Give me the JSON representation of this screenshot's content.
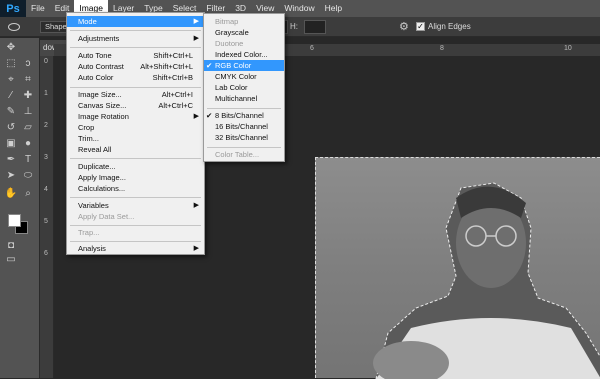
{
  "app": {
    "logo": "Ps"
  },
  "menubar": [
    "File",
    "Edit",
    "Image",
    "Layer",
    "Type",
    "Select",
    "Filter",
    "3D",
    "View",
    "Window",
    "Help"
  ],
  "options_bar": {
    "shape_label": "Shape",
    "height_label": "H:",
    "align_edges": "Align Edges"
  },
  "document_tab": "dow",
  "ruler_v": [
    "0",
    "1",
    "2",
    "3",
    "4",
    "5",
    "6"
  ],
  "ruler_h": [
    "6",
    "8",
    "10"
  ],
  "image_menu": {
    "mode": "Mode",
    "adjustments": "Adjustments",
    "auto_tone": {
      "label": "Auto Tone",
      "shortcut": "Shift+Ctrl+L"
    },
    "auto_contrast": {
      "label": "Auto Contrast",
      "shortcut": "Alt+Shift+Ctrl+L"
    },
    "auto_color": {
      "label": "Auto Color",
      "shortcut": "Shift+Ctrl+B"
    },
    "image_size": {
      "label": "Image Size...",
      "shortcut": "Alt+Ctrl+I"
    },
    "canvas_size": {
      "label": "Canvas Size...",
      "shortcut": "Alt+Ctrl+C"
    },
    "image_rotation": "Image Rotation",
    "crop": "Crop",
    "trim": "Trim...",
    "reveal_all": "Reveal All",
    "duplicate": "Duplicate...",
    "apply_image": "Apply Image...",
    "calculations": "Calculations...",
    "variables": "Variables",
    "apply_data_set": "Apply Data Set...",
    "trap": "Trap...",
    "analysis": "Analysis"
  },
  "mode_menu": {
    "bitmap": "Bitmap",
    "grayscale": "Grayscale",
    "duotone": "Duotone",
    "indexed_color": "Indexed Color...",
    "rgb_color": "RGB Color",
    "cmyk_color": "CMYK Color",
    "lab_color": "Lab Color",
    "multichannel": "Multichannel",
    "bits8": "8 Bits/Channel",
    "bits16": "16 Bits/Channel",
    "bits32": "32 Bits/Channel",
    "color_table": "Color Table...",
    "checkmark": "✔"
  },
  "colors": {
    "highlight": "#3297fd",
    "menubar": "#535353",
    "canvas": "#282828",
    "menu_bg": "#f0f0f0"
  }
}
